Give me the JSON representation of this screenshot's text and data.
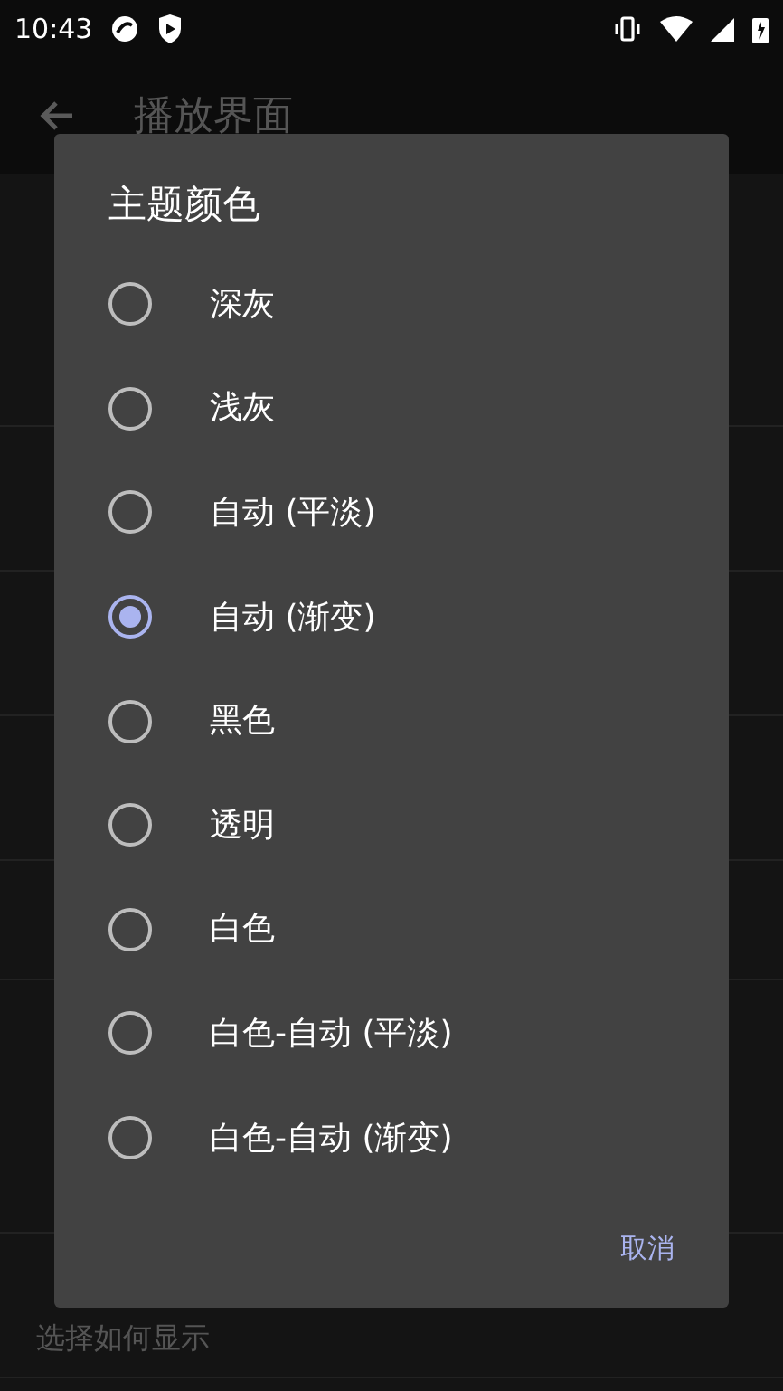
{
  "status_bar": {
    "time": "10:43"
  },
  "app_bar": {
    "title": "播放界面"
  },
  "background_list": [
    {
      "kind": "header"
    },
    {
      "kind": "row"
    },
    {
      "kind": "row"
    },
    {
      "kind": "row"
    },
    {
      "kind": "row"
    },
    {
      "kind": "dim"
    },
    {
      "kind": "header"
    },
    {
      "kind": "row"
    },
    {
      "kind": "row",
      "subtitle": "选择如何显示"
    }
  ],
  "dialog": {
    "title": "主题颜色",
    "options": [
      {
        "label": "深灰",
        "selected": false
      },
      {
        "label": "浅灰",
        "selected": false
      },
      {
        "label": "自动 (平淡)",
        "selected": false
      },
      {
        "label": "自动 (渐变)",
        "selected": true
      },
      {
        "label": "黑色",
        "selected": false
      },
      {
        "label": "透明",
        "selected": false
      },
      {
        "label": "白色",
        "selected": false
      },
      {
        "label": "白色-自动 (平淡)",
        "selected": false
      },
      {
        "label": "白色-自动 (渐变)",
        "selected": false
      }
    ],
    "cancel_button": "取消"
  }
}
